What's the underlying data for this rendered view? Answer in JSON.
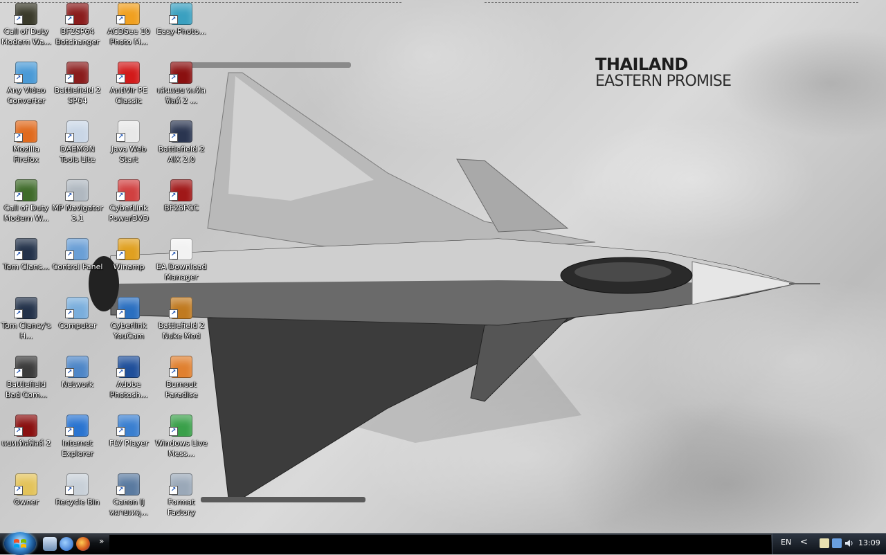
{
  "wallpaper": {
    "brand_line1": "THAILAND",
    "brand_line2": "EASTERN PROMISE"
  },
  "desktop_icons": [
    {
      "label": "Call of Duty Modern Wa...",
      "icon": "cod-icon",
      "color": "#3a3a2a"
    },
    {
      "label": "Any Video Converter",
      "icon": "video-converter-icon",
      "color": "#4a9ad6"
    },
    {
      "label": "Mozilla Firefox",
      "icon": "firefox-icon",
      "color": "#e06a1d"
    },
    {
      "label": "Call of Duty Modern W...",
      "icon": "cod-icon",
      "color": "#3f6b2a"
    },
    {
      "label": "Tom Clanc...",
      "icon": "tom-clancy-icon",
      "color": "#23324a"
    },
    {
      "label": "Tom Clancy's H...",
      "icon": "tom-clancy-icon",
      "color": "#23324a"
    },
    {
      "label": "Battlefield Bad Com...",
      "icon": "battlefield-bc-icon",
      "color": "#3b3b3b"
    },
    {
      "label": "แบทเทิลฟิลด์ 2",
      "icon": "battlefield-icon",
      "color": "#8a1010"
    },
    {
      "label": "Owner",
      "icon": "user-folder-icon",
      "color": "#e3c35a"
    },
    {
      "label": "BF2SP64 Botchanger",
      "icon": "bf2-icon",
      "color": "#8a1c1c"
    },
    {
      "label": "Battlefield 2 SP64",
      "icon": "bf2-icon",
      "color": "#8a1c1c"
    },
    {
      "label": "DAEMON Tools Lite",
      "icon": "daemon-tools-icon",
      "color": "#c9d6e6"
    },
    {
      "label": "MP Navigator 3.1",
      "icon": "mp-navigator-icon",
      "color": "#b0b8c0"
    },
    {
      "label": "Control Panel",
      "icon": "control-panel-icon",
      "color": "#6a9fd6"
    },
    {
      "label": "Computer",
      "icon": "computer-icon",
      "color": "#7aaedc"
    },
    {
      "label": "Network",
      "icon": "network-icon",
      "color": "#4e86c7"
    },
    {
      "label": "Internet Explorer",
      "icon": "ie-icon",
      "color": "#2a74d0"
    },
    {
      "label": "Recycle Bin",
      "icon": "recycle-bin-icon",
      "color": "#c8d0d8"
    },
    {
      "label": "ACDSee 10 Photo M...",
      "icon": "acdsee-icon",
      "color": "#f0a020"
    },
    {
      "label": "AntiVir PE Classic",
      "icon": "antivir-icon",
      "color": "#d21a1a"
    },
    {
      "label": "Java Web Start",
      "icon": "java-icon",
      "color": "#e8e8e8"
    },
    {
      "label": "CyberLink PowerDVD",
      "icon": "powerdvd-icon",
      "color": "#d04040"
    },
    {
      "label": "Winamp",
      "icon": "winamp-icon",
      "color": "#e0a020"
    },
    {
      "label": "Cyberlink YouCam",
      "icon": "youcam-icon",
      "color": "#2a6fc0"
    },
    {
      "label": "Adobe Photosh...",
      "icon": "photoshop-icon",
      "color": "#1f4f9a"
    },
    {
      "label": "FLV Player",
      "icon": "flv-player-icon",
      "color": "#3a7fd0"
    },
    {
      "label": "Canon IJ หมายเหตุ...",
      "icon": "canon-icon",
      "color": "#5a7aa0"
    },
    {
      "label": "Easy-Photo...",
      "icon": "easy-photo-icon",
      "color": "#3aa0c0"
    },
    {
      "label": "เล่นแบบ ทะทิลฟิลด์ 2 ...",
      "icon": "battlefield-icon",
      "color": "#8a1010"
    },
    {
      "label": "Battlefield 2 AIX 2.0",
      "icon": "aix-icon",
      "color": "#2a3550"
    },
    {
      "label": "BF2SPCC",
      "icon": "bf2spcc-icon",
      "color": "#a01818"
    },
    {
      "label": "EA Download Manager",
      "icon": "ea-download-icon",
      "color": "#f2f2f2"
    },
    {
      "label": "Battlefield 2 Nuke Mod",
      "icon": "nuke-mod-icon",
      "color": "#c07a20"
    },
    {
      "label": "Burnout Paradise",
      "icon": "burnout-icon",
      "color": "#e08030"
    },
    {
      "label": "Windows Live Mess...",
      "icon": "messenger-icon",
      "color": "#3aa04a"
    },
    {
      "label": "Format Factory",
      "icon": "format-factory-icon",
      "color": "#9aa8b8"
    }
  ],
  "taskbar": {
    "more_glyph": "»",
    "language": "EN",
    "chevron": "<",
    "clock": "13:09"
  }
}
